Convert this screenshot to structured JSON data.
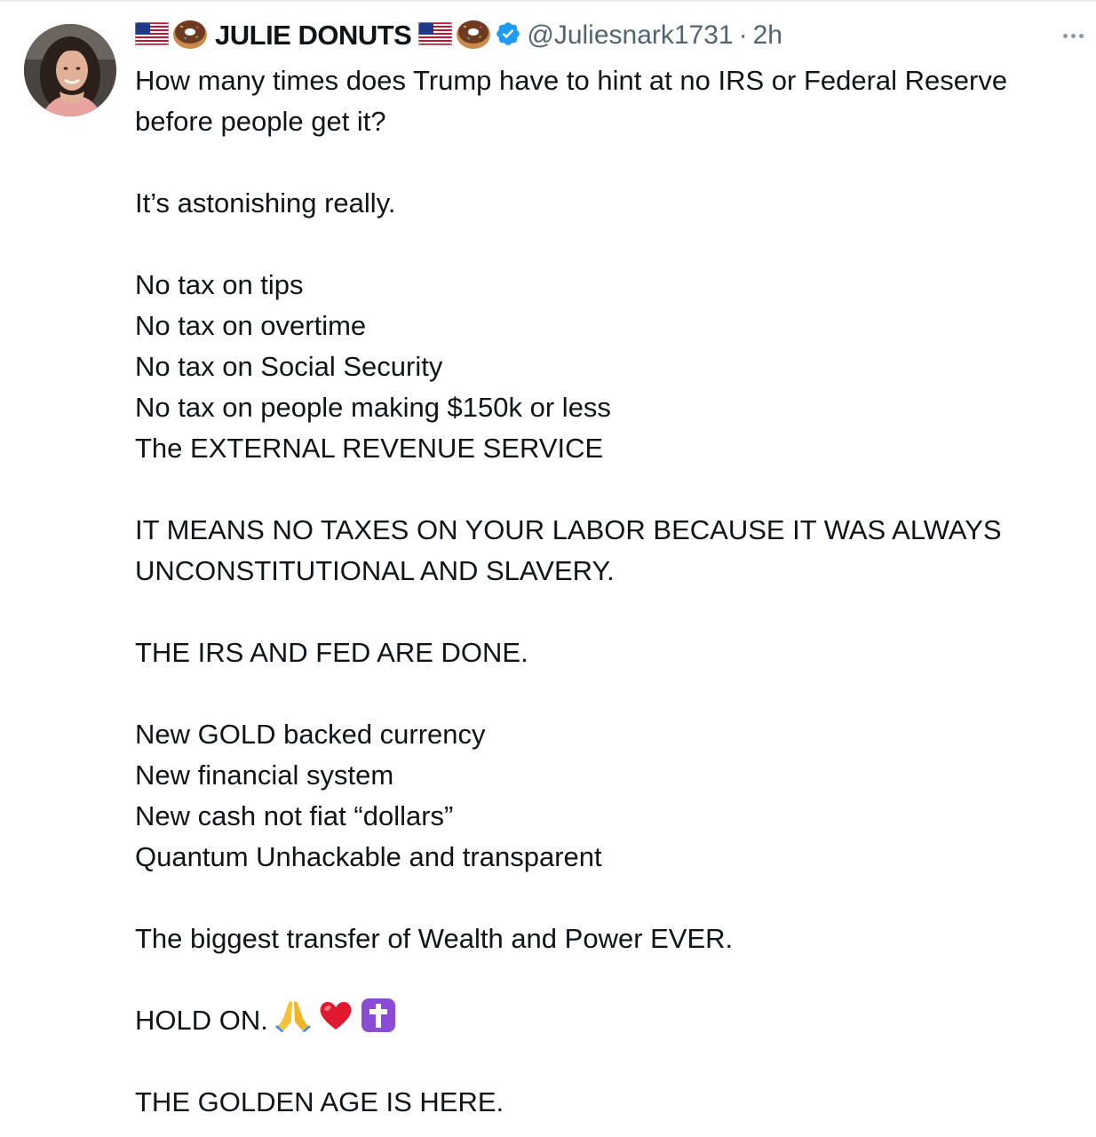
{
  "tweet": {
    "author": {
      "display_name": "JULIE DONUTS",
      "handle": "@Juliesnark1731",
      "separator": "·",
      "time": "2h",
      "name_emoji": [
        "us-flag",
        "donut"
      ],
      "suffix_emoji": [
        "us-flag",
        "donut"
      ],
      "verified": true,
      "verified_color": "#1d9bf0"
    },
    "body": {
      "p1_l1": "How many times does Trump have to hint at no IRS or Federal Reserve",
      "p1_l2": "before people get it?",
      "p2": "It’s astonishing really.",
      "list1": [
        "No tax on tips",
        "No tax on overtime",
        "No tax on Social Security",
        "No tax on people making $150k or less",
        "The EXTERNAL REVENUE SERVICE"
      ],
      "p3_l1": "IT MEANS NO TAXES ON YOUR LABOR BECAUSE IT WAS ALWAYS",
      "p3_l2": "UNCONSTITUTIONAL AND SLAVERY.",
      "p4": "THE IRS AND FED ARE DONE.",
      "list2": [
        "New GOLD backed currency",
        "New financial system",
        "New cash not fiat “dollars”",
        "Quantum Unhackable and transparent"
      ],
      "p5": "The biggest transfer of Wealth and Power EVER.",
      "p6": "HOLD ON.",
      "p6_emoji": [
        "folded-hands",
        "red-heart",
        "latin-cross"
      ],
      "p7": "THE GOLDEN AGE IS HERE."
    },
    "colors": {
      "text": "#0f1419",
      "secondary": "#536471",
      "verified": "#1d9bf0"
    }
  }
}
